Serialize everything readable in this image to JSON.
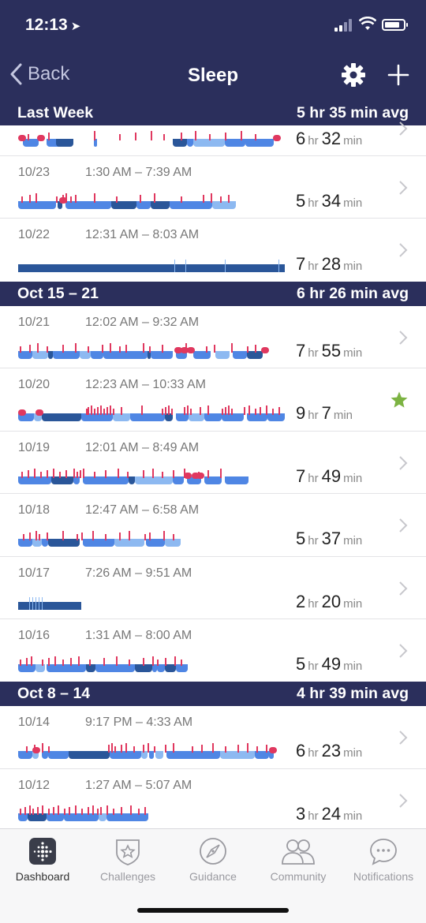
{
  "status": {
    "time": "12:13"
  },
  "nav": {
    "back_label": "Back",
    "title": "Sleep"
  },
  "sections": [
    {
      "label": "Last Week",
      "avg": "5 hr 35 min avg"
    },
    {
      "label": "Oct 15 – 21",
      "avg": "6 hr 26 min avg"
    },
    {
      "label": "Oct 8 – 14",
      "avg": "4 hr 39 min avg"
    }
  ],
  "entries": [
    {
      "date": "",
      "range": "",
      "hr": "6",
      "min": "32",
      "hr_unit": "hr",
      "min_unit": "min"
    },
    {
      "date": "10/23",
      "range": "1:30 AM – 7:39 AM",
      "hr": "5",
      "min": "34",
      "hr_unit": "hr",
      "min_unit": "min"
    },
    {
      "date": "10/22",
      "range": "12:31 AM – 8:03 AM",
      "hr": "7",
      "min": "28",
      "hr_unit": "hr",
      "min_unit": "min"
    },
    {
      "date": "10/21",
      "range": "12:02 AM – 9:32 AM",
      "hr": "7",
      "min": "55",
      "hr_unit": "hr",
      "min_unit": "min"
    },
    {
      "date": "10/20",
      "range": "12:23 AM – 10:33 AM",
      "hr": "9",
      "min": "7",
      "hr_unit": "hr",
      "min_unit": "min"
    },
    {
      "date": "10/19",
      "range": "12:01 AM – 8:49 AM",
      "hr": "7",
      "min": "49",
      "hr_unit": "hr",
      "min_unit": "min"
    },
    {
      "date": "10/18",
      "range": "12:47 AM – 6:58 AM",
      "hr": "5",
      "min": "37",
      "hr_unit": "hr",
      "min_unit": "min"
    },
    {
      "date": "10/17",
      "range": "7:26 AM – 9:51 AM",
      "hr": "2",
      "min": "20",
      "hr_unit": "hr",
      "min_unit": "min"
    },
    {
      "date": "10/16",
      "range": "1:31 AM – 8:00 AM",
      "hr": "5",
      "min": "49",
      "hr_unit": "hr",
      "min_unit": "min"
    },
    {
      "date": "10/14",
      "range": "9:17 PM – 4:33 AM",
      "hr": "6",
      "min": "23",
      "hr_unit": "hr",
      "min_unit": "min"
    },
    {
      "date": "10/12",
      "range": "1:27 AM – 5:07 AM",
      "hr": "3",
      "min": "24",
      "hr_unit": "hr",
      "min_unit": "min"
    }
  ],
  "tabs": [
    {
      "label": "Dashboard",
      "icon": "dashboard-icon"
    },
    {
      "label": "Challenges",
      "icon": "challenges-icon"
    },
    {
      "label": "Guidance",
      "icon": "compass-icon"
    },
    {
      "label": "Community",
      "icon": "community-icon"
    },
    {
      "label": "Notifications",
      "icon": "chat-bubble-icon"
    }
  ],
  "colors": {
    "header_bg": "#2b2f5c",
    "stage_deep": "#2a5699",
    "stage_core": "#4f86e4",
    "stage_light": "#8db9f1",
    "stage_wake": "#e0385f",
    "star": "#7cb342"
  }
}
